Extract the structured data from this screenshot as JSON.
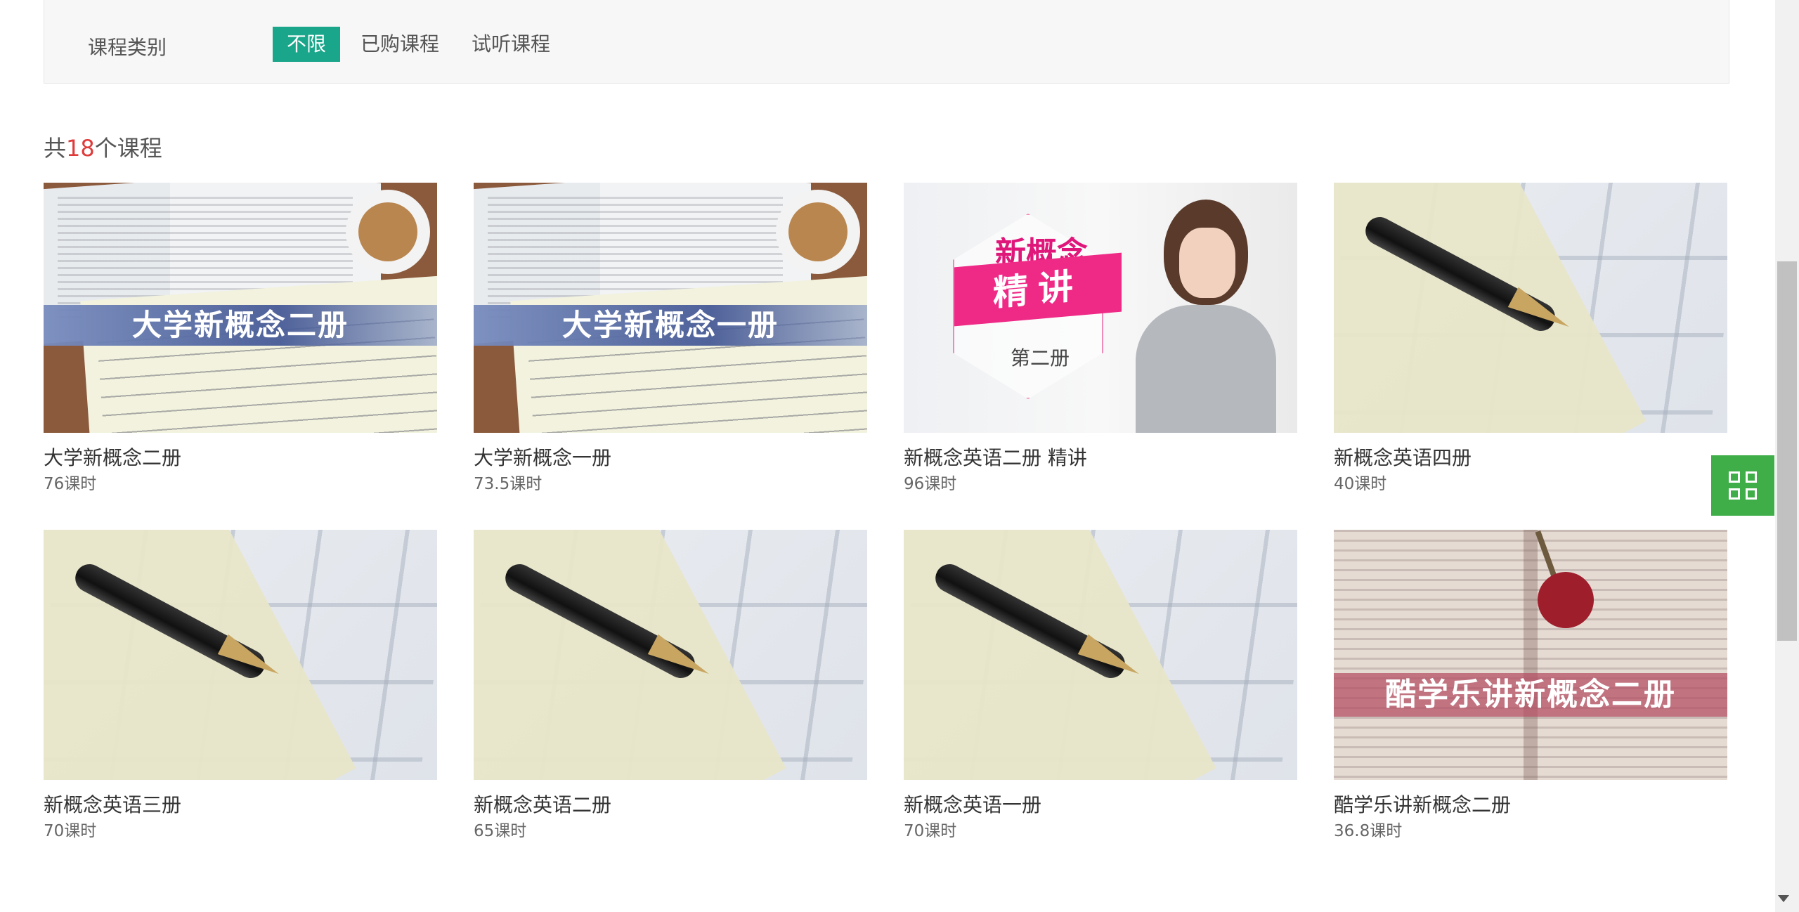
{
  "filter": {
    "label": "课程类别",
    "options": [
      "不限",
      "已购课程",
      "试听课程"
    ],
    "active": "不限",
    "active_color": "#1aa68a"
  },
  "summary": {
    "prefix": "共",
    "count": "18",
    "suffix": "个课程",
    "count_color": "#e03b3b"
  },
  "courses": [
    {
      "title": "大学新概念二册",
      "hours": "76课时",
      "banner": "大学新概念二册"
    },
    {
      "title": "大学新概念一册",
      "hours": "73.5课时",
      "banner": "大学新概念一册"
    },
    {
      "title": "新概念英语二册 精讲",
      "hours": "96课时",
      "cover_top": "新概念",
      "cover_main": "精讲",
      "cover_sub": "第二册"
    },
    {
      "title": "新概念英语四册",
      "hours": "40课时"
    },
    {
      "title": "新概念英语三册",
      "hours": "70课时"
    },
    {
      "title": "新概念英语二册",
      "hours": "65课时"
    },
    {
      "title": "新概念英语一册",
      "hours": "70课时"
    },
    {
      "title": "酷学乐讲新概念二册",
      "hours": "36.8课时",
      "banner": "酷学乐讲新概念二册"
    }
  ],
  "float_button": {
    "icon": "qr-code-icon",
    "color": "#3fae49"
  }
}
